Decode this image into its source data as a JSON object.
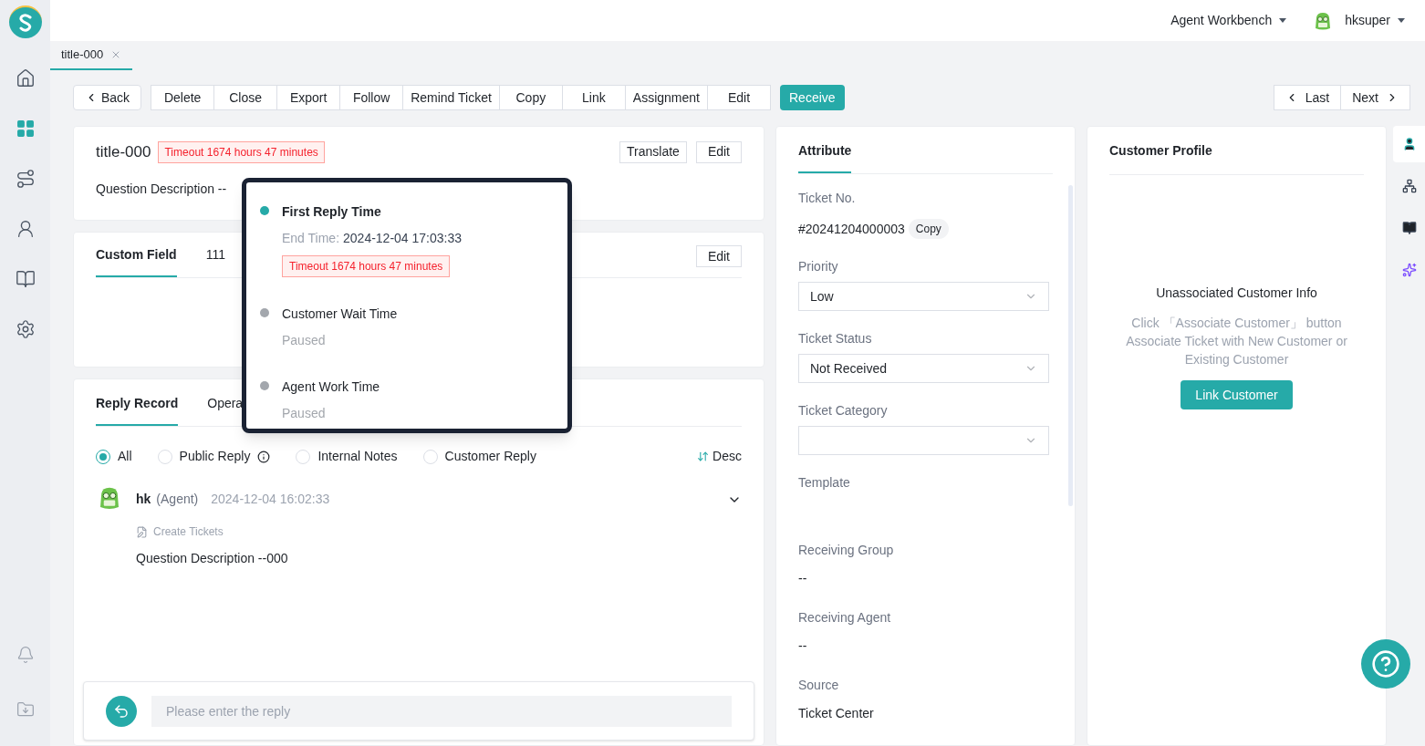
{
  "header": {
    "workbench_menu": "Agent Workbench",
    "user": "hksuper"
  },
  "sidebar": {
    "items": [
      {
        "kind": "home",
        "selected": false
      },
      {
        "kind": "apps",
        "selected": true
      },
      {
        "kind": "route",
        "selected": false
      },
      {
        "kind": "agent",
        "selected": false
      },
      {
        "kind": "book",
        "selected": false
      },
      {
        "kind": "settings",
        "selected": false
      }
    ],
    "bottom_items": [
      {
        "kind": "bell"
      },
      {
        "kind": "download"
      }
    ]
  },
  "tabs": [
    {
      "label": "title-000",
      "selected": true
    }
  ],
  "toolbar": {
    "back": "Back",
    "actions": [
      "Delete",
      "Close",
      "Export",
      "Follow",
      "Remind Ticket",
      "Copy",
      "Link",
      "Assignment",
      "Edit"
    ],
    "receive": "Receive",
    "last": "Last",
    "next": "Next"
  },
  "ticket": {
    "title": "title-000",
    "timeout_badge": "Timeout 1674 hours 47 minutes",
    "translate": "Translate",
    "edit": "Edit",
    "description": "Question Description --"
  },
  "custom_fields": {
    "tabs": [
      {
        "label": "Custom Field",
        "selected": true
      },
      {
        "label": "111",
        "selected": false
      }
    ],
    "edit": "Edit"
  },
  "records": {
    "tabs": [
      {
        "label": "Reply Record",
        "selected": true
      },
      {
        "label": "Opera",
        "selected": false
      }
    ],
    "filters": [
      {
        "label": "All",
        "selected": true,
        "info": false
      },
      {
        "label": "Public Reply",
        "selected": false,
        "info": true
      },
      {
        "label": "Internal Notes",
        "selected": false,
        "info": false
      },
      {
        "label": "Customer Reply",
        "selected": false,
        "info": false
      }
    ],
    "sort": "Desc",
    "entries": [
      {
        "author": "hk",
        "role": "(Agent)",
        "time": "2024-12-04 16:02:33",
        "action": "Create Tickets",
        "content": "Question Description --000"
      }
    ],
    "reply_placeholder": "Please enter the reply"
  },
  "sla_popover": {
    "items": [
      {
        "title": "First Reply Time",
        "active": true,
        "end_label": "End Time:",
        "end_value": "2024-12-04 17:03:33",
        "badge": "Timeout 1674 hours 47 minutes"
      },
      {
        "title": "Customer Wait Time",
        "active": false,
        "status": "Paused"
      },
      {
        "title": "Agent Work Time",
        "active": false,
        "status": "Paused"
      }
    ]
  },
  "attributes": {
    "tab": "Attribute",
    "fields": [
      {
        "kind": "copy",
        "label": "Ticket No.",
        "value": "#20241204000003",
        "action": "Copy"
      },
      {
        "kind": "select",
        "label": "Priority",
        "value": "Low"
      },
      {
        "kind": "select",
        "label": "Ticket Status",
        "value": "Not Received"
      },
      {
        "kind": "select",
        "label": "Ticket Category"
      },
      {
        "kind": "text",
        "label": "Template"
      },
      {
        "kind": "text",
        "label": "Receiving Group",
        "value": "--"
      },
      {
        "kind": "text",
        "label": "Receiving Agent",
        "value": "--"
      },
      {
        "kind": "text",
        "label": "Source",
        "value": "Ticket Center"
      }
    ]
  },
  "customer_profile": {
    "title": "Customer Profile",
    "empty_title": "Unassociated Customer Info",
    "empty_text": "Click 「Associate Customer」 button Associate Ticket with New Customer or Existing Customer",
    "button": "Link Customer"
  },
  "side_tools": [
    {
      "kind": "person",
      "selected": true
    },
    {
      "kind": "tree",
      "selected": false
    },
    {
      "kind": "book",
      "selected": false
    },
    {
      "kind": "sparkle",
      "selected": false
    }
  ]
}
